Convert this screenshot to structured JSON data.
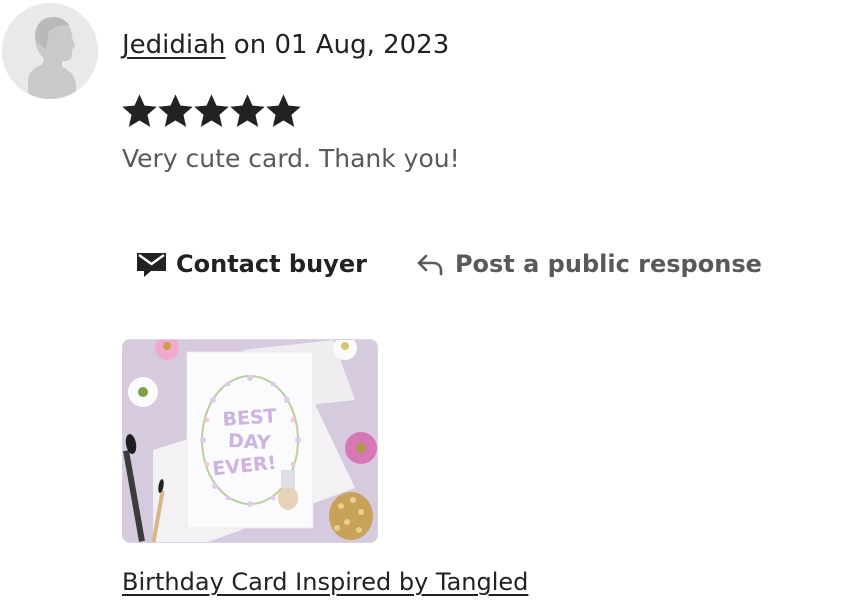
{
  "review": {
    "author": "Jedidiah",
    "date_prefix": " on ",
    "date": "01 Aug, 2023",
    "rating": 5,
    "rating_max": 5,
    "text": "Very cute card. Thank you!"
  },
  "actions": {
    "contact_label": "Contact buyer",
    "respond_label": "Post a public response"
  },
  "listing": {
    "title": "Birthday Card Inspired by Tangled",
    "thumbnail_text_lines": [
      "BEST",
      "DAY",
      "EVER!"
    ]
  },
  "icons": {
    "avatar": "default-avatar-icon",
    "star": "star-icon",
    "contact": "envelope-icon",
    "respond": "reply-arrow-icon"
  },
  "colors": {
    "text_primary": "#222222",
    "text_secondary": "#595959",
    "avatar_bg": "#e9e9e7",
    "avatar_silhouette": "#c9c9c7",
    "star": "#222222",
    "thumbnail_bg": "#d5cade",
    "card_lettering": "#cdb4e0"
  }
}
